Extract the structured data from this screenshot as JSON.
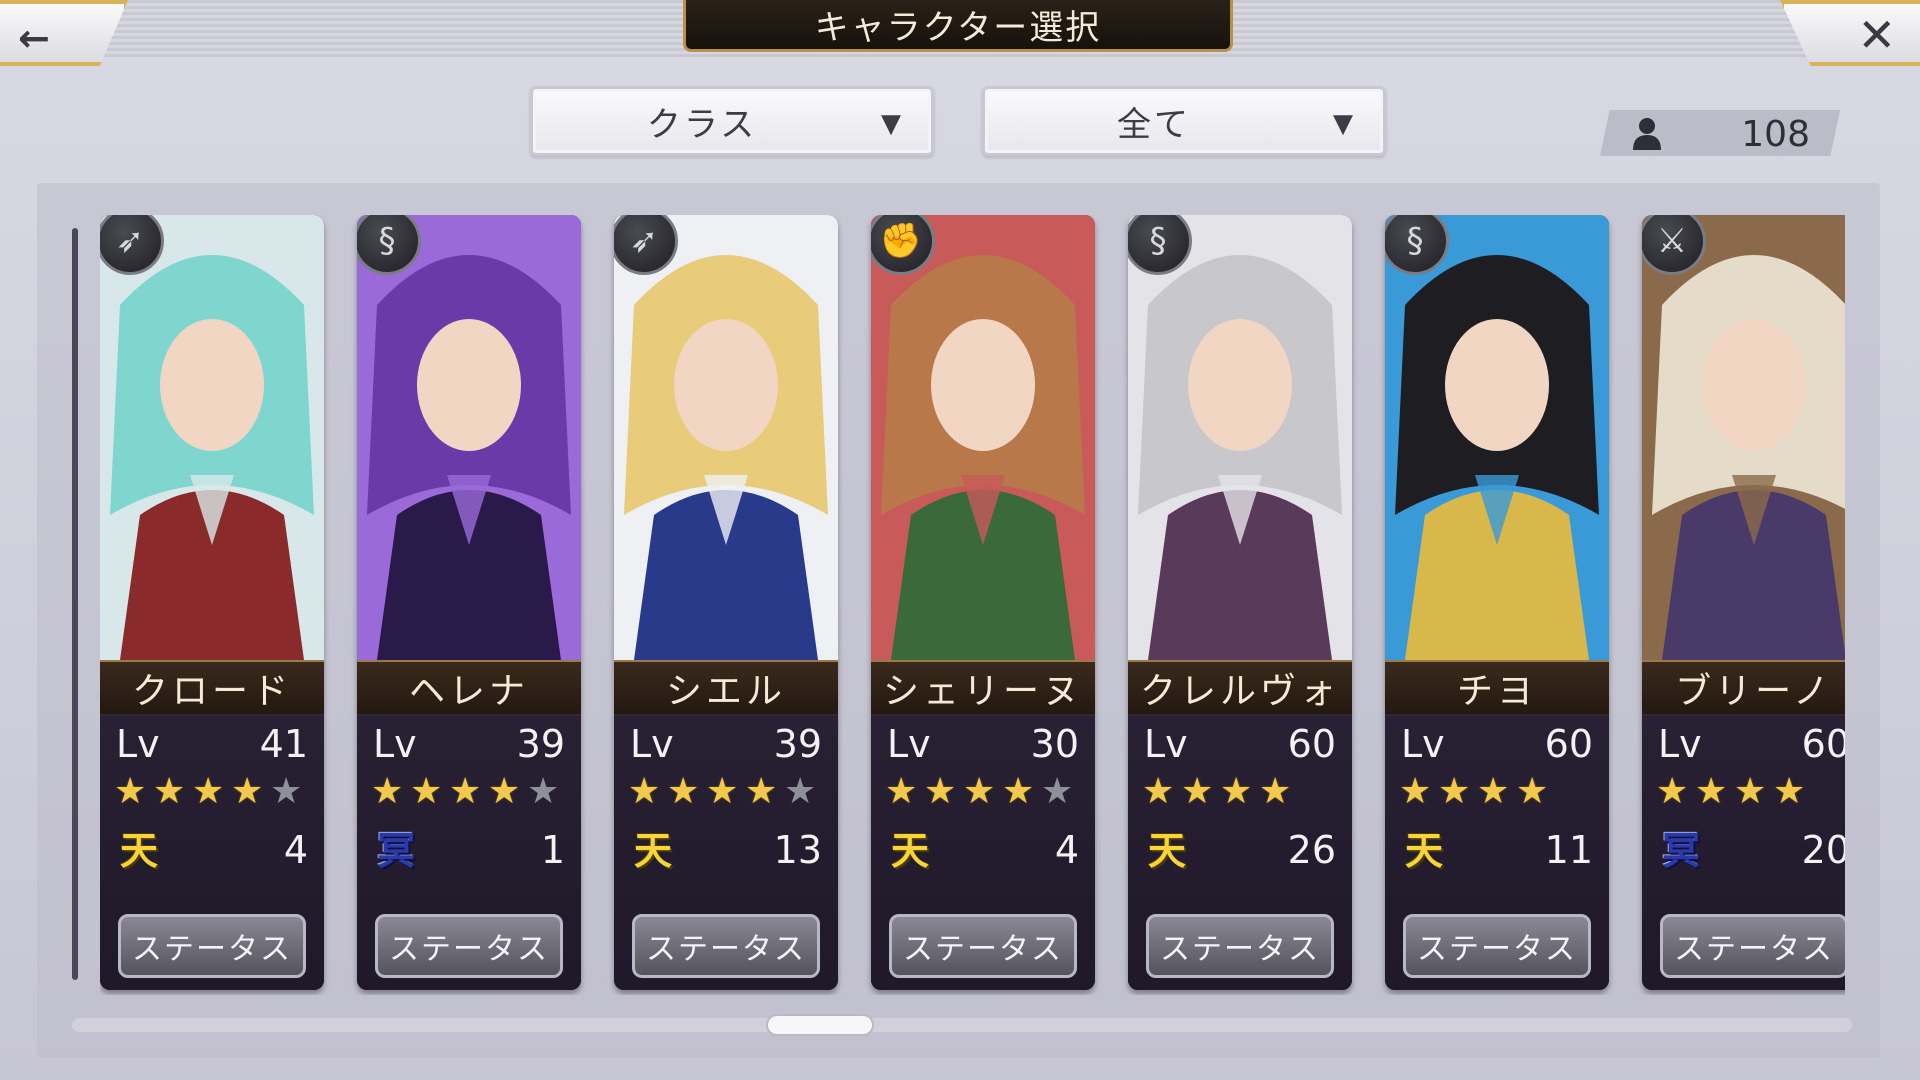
{
  "header": {
    "title": "キャラクター選択",
    "back_icon": "←",
    "close_icon": "✕"
  },
  "filters": {
    "class": {
      "value": "クラス",
      "caret": "▼"
    },
    "rarity": {
      "value": "全て",
      "caret": "▼"
    }
  },
  "unit_count": "108",
  "status_label": "ステータス",
  "lv_label": "Lv",
  "characters": [
    {
      "name": "クロード",
      "level": "41",
      "stars": 4,
      "max_stars": 5,
      "rank_glyph": "天",
      "rank_type": "ten",
      "rank_num": "4",
      "class_icon": "bow-icon",
      "palette": [
        "#7fd6cf",
        "#d8e8ea",
        "#8a2a2a"
      ]
    },
    {
      "name": "ヘレナ",
      "level": "39",
      "stars": 4,
      "max_stars": 5,
      "rank_glyph": "冥",
      "rank_type": "mei",
      "rank_num": "1",
      "class_icon": "staff-icon",
      "palette": [
        "#6a3aa8",
        "#9a6ad8",
        "#2a1a4a"
      ]
    },
    {
      "name": "シエル",
      "level": "39",
      "stars": 4,
      "max_stars": 5,
      "rank_glyph": "天",
      "rank_type": "ten",
      "rank_num": "13",
      "class_icon": "bow-icon",
      "palette": [
        "#e8cc7a",
        "#eef0f4",
        "#2a3a8a"
      ]
    },
    {
      "name": "シェリーヌ",
      "level": "30",
      "stars": 4,
      "max_stars": 5,
      "rank_glyph": "天",
      "rank_type": "ten",
      "rank_num": "4",
      "class_icon": "fist-icon",
      "palette": [
        "#b8784a",
        "#c85a5a",
        "#3a6a3a"
      ]
    },
    {
      "name": "クレルヴォ",
      "level": "60",
      "stars": 4,
      "max_stars": 4,
      "rank_glyph": "天",
      "rank_type": "ten",
      "rank_num": "26",
      "class_icon": "staff-icon",
      "palette": [
        "#c8c8cc",
        "#e4e4e8",
        "#5a3a5a"
      ]
    },
    {
      "name": "チヨ",
      "level": "60",
      "stars": 4,
      "max_stars": 4,
      "rank_glyph": "天",
      "rank_type": "ten",
      "rank_num": "11",
      "class_icon": "staff-icon",
      "palette": [
        "#1e1e22",
        "#3a9ad8",
        "#d8b84a"
      ]
    },
    {
      "name": "ブリーノ",
      "level": "60",
      "stars": 4,
      "max_stars": 4,
      "rank_glyph": "冥",
      "rank_type": "mei",
      "rank_num": "20",
      "class_icon": "sword-icon",
      "palette": [
        "#e4dcc8",
        "#8a6a4a",
        "#4a3a6a"
      ]
    }
  ],
  "icon_glyphs": {
    "bow-icon": "➶",
    "staff-icon": "§",
    "fist-icon": "✊",
    "sword-icon": "⚔"
  }
}
